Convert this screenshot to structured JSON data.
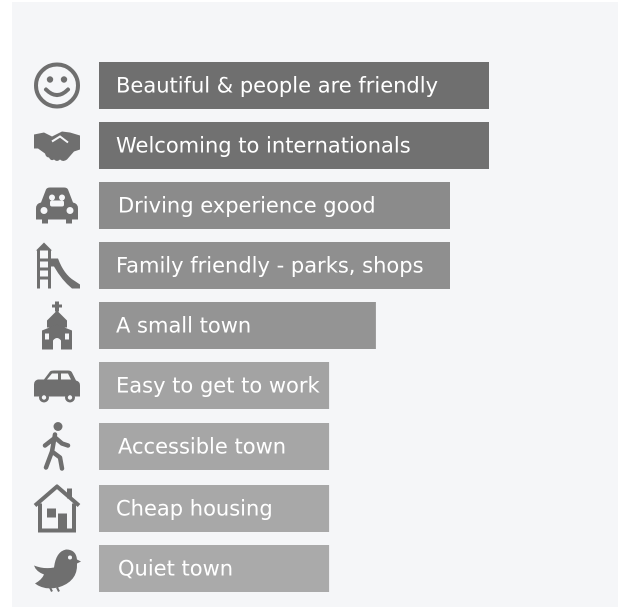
{
  "chart_data": {
    "type": "bar",
    "orientation": "horizontal",
    "categories": [
      "Beautiful & people are friendly",
      "Welcoming to internationals",
      "Driving experience good",
      "Family friendly - parks, shops",
      "A small town",
      "Easy to get to work",
      "Accessible town",
      "Cheap housing",
      "Quiet town"
    ],
    "values": [
      100,
      100,
      90,
      90,
      71,
      59,
      59,
      59,
      59
    ],
    "xlim": [
      0,
      100
    ],
    "grid": false,
    "legend": "none",
    "icons": [
      "smiley-icon",
      "handshake-icon",
      "car-front-icon",
      "playground-icon",
      "church-icon",
      "car-side-icon",
      "walking-person-icon",
      "house-icon",
      "bird-icon"
    ],
    "bar_colors": [
      "#6f6f6f",
      "#717171",
      "#8b8b8b",
      "#8f8f8f",
      "#949494",
      "#a3a3a3",
      "#a6a6a6",
      "#a8a8a8",
      "#aaaaaa"
    ]
  }
}
